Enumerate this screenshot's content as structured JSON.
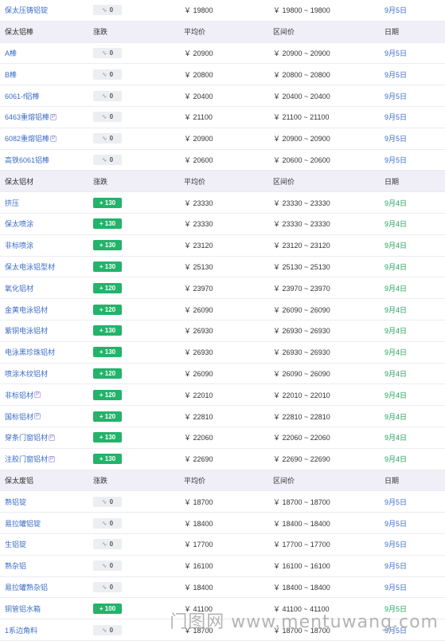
{
  "watermark": "门图网 www.mentuwang.com",
  "sections": [
    {
      "header": {
        "name": "保太压铸铝锭",
        "change_label": "",
        "avg_label": "",
        "range_label": "",
        "date_label": "",
        "hidden_header": true
      },
      "rows": [
        {
          "name": "保太压铸铝锭",
          "change": "0",
          "change_type": "zero",
          "avg": "￥ 19800",
          "range": "￥ 19800 ~ 19800",
          "date": "9月5日",
          "date_color": "blue",
          "mark": false
        }
      ]
    },
    {
      "header": {
        "name": "保太铝棒",
        "change_label": "涨跌",
        "avg_label": "平均价",
        "range_label": "区间价",
        "date_label": "日期"
      },
      "rows": [
        {
          "name": "A棒",
          "change": "0",
          "change_type": "zero",
          "avg": "￥ 20900",
          "range": "￥ 20900 ~ 20900",
          "date": "9月5日",
          "date_color": "blue",
          "mark": false
        },
        {
          "name": "B棒",
          "change": "0",
          "change_type": "zero",
          "avg": "￥ 20800",
          "range": "￥ 20800 ~ 20800",
          "date": "9月5日",
          "date_color": "blue",
          "mark": false
        },
        {
          "name": "6061-f铝棒",
          "change": "0",
          "change_type": "zero",
          "avg": "￥ 20400",
          "range": "￥ 20400 ~ 20400",
          "date": "9月5日",
          "date_color": "blue",
          "mark": false
        },
        {
          "name": "6463重熔铝棒",
          "change": "0",
          "change_type": "zero",
          "avg": "￥ 21100",
          "range": "￥ 21100 ~ 21100",
          "date": "9月5日",
          "date_color": "blue",
          "mark": true
        },
        {
          "name": "6082重熔铝棒",
          "change": "0",
          "change_type": "zero",
          "avg": "￥ 20900",
          "range": "￥ 20900 ~ 20900",
          "date": "9月5日",
          "date_color": "blue",
          "mark": true
        },
        {
          "name": "高铁6061铝棒",
          "change": "0",
          "change_type": "zero",
          "avg": "￥ 20600",
          "range": "￥ 20600 ~ 20600",
          "date": "9月5日",
          "date_color": "blue",
          "mark": false
        }
      ]
    },
    {
      "header": {
        "name": "保太铝材",
        "change_label": "涨跌",
        "avg_label": "平均价",
        "range_label": "区间价",
        "date_label": "日期"
      },
      "rows": [
        {
          "name": "挤压",
          "change": "+ 130",
          "change_type": "up",
          "avg": "￥ 23330",
          "range": "￥ 23330 ~ 23330",
          "date": "9月4日",
          "date_color": "green",
          "mark": false
        },
        {
          "name": "保太喷涂",
          "change": "+ 130",
          "change_type": "up",
          "avg": "￥ 23330",
          "range": "￥ 23330 ~ 23330",
          "date": "9月4日",
          "date_color": "green",
          "mark": false
        },
        {
          "name": "非标喷涂",
          "change": "+ 130",
          "change_type": "up",
          "avg": "￥ 23120",
          "range": "￥ 23120 ~ 23120",
          "date": "9月4日",
          "date_color": "green",
          "mark": false
        },
        {
          "name": "保太电泳铝型材",
          "change": "+ 130",
          "change_type": "up",
          "avg": "￥ 25130",
          "range": "￥ 25130 ~ 25130",
          "date": "9月4日",
          "date_color": "green",
          "mark": false
        },
        {
          "name": "氧化铝材",
          "change": "+ 120",
          "change_type": "up",
          "avg": "￥ 23970",
          "range": "￥ 23970 ~ 23970",
          "date": "9月4日",
          "date_color": "green",
          "mark": false
        },
        {
          "name": "金黄电泳铝材",
          "change": "+ 120",
          "change_type": "up",
          "avg": "￥ 26090",
          "range": "￥ 26090 ~ 26090",
          "date": "9月4日",
          "date_color": "green",
          "mark": false
        },
        {
          "name": "紫铜电泳铝材",
          "change": "+ 130",
          "change_type": "up",
          "avg": "￥ 26930",
          "range": "￥ 26930 ~ 26930",
          "date": "9月4日",
          "date_color": "green",
          "mark": false
        },
        {
          "name": "电泳黑珍珠铝材",
          "change": "+ 130",
          "change_type": "up",
          "avg": "￥ 26930",
          "range": "￥ 26930 ~ 26930",
          "date": "9月4日",
          "date_color": "green",
          "mark": false
        },
        {
          "name": "喷涂木纹铝材",
          "change": "+ 120",
          "change_type": "up",
          "avg": "￥ 26090",
          "range": "￥ 26090 ~ 26090",
          "date": "9月4日",
          "date_color": "green",
          "mark": false
        },
        {
          "name": "非标铝材",
          "change": "+ 120",
          "change_type": "up",
          "avg": "￥ 22010",
          "range": "￥ 22010 ~ 22010",
          "date": "9月4日",
          "date_color": "green",
          "mark": true
        },
        {
          "name": "国标铝材",
          "change": "+ 120",
          "change_type": "up",
          "avg": "￥ 22810",
          "range": "￥ 22810 ~ 22810",
          "date": "9月4日",
          "date_color": "green",
          "mark": true
        },
        {
          "name": "穿条门窗铝材",
          "change": "+ 130",
          "change_type": "up",
          "avg": "￥ 22060",
          "range": "￥ 22060 ~ 22060",
          "date": "9月4日",
          "date_color": "green",
          "mark": true
        },
        {
          "name": "注胶门窗铝材",
          "change": "+ 130",
          "change_type": "up",
          "avg": "￥ 22690",
          "range": "￥ 22690 ~ 22690",
          "date": "9月4日",
          "date_color": "green",
          "mark": true
        }
      ]
    },
    {
      "header": {
        "name": "保太废铝",
        "change_label": "涨跌",
        "avg_label": "平均价",
        "range_label": "区间价",
        "date_label": "日期"
      },
      "rows": [
        {
          "name": "熟铝锭",
          "change": "0",
          "change_type": "zero",
          "avg": "￥ 18700",
          "range": "￥ 18700 ~ 18700",
          "date": "9月5日",
          "date_color": "blue",
          "mark": false
        },
        {
          "name": "易拉罐铝锭",
          "change": "0",
          "change_type": "zero",
          "avg": "￥ 18400",
          "range": "￥ 18400 ~ 18400",
          "date": "9月5日",
          "date_color": "blue",
          "mark": false
        },
        {
          "name": "生铝锭",
          "change": "0",
          "change_type": "zero",
          "avg": "￥ 17700",
          "range": "￥ 17700 ~ 17700",
          "date": "9月5日",
          "date_color": "blue",
          "mark": false
        },
        {
          "name": "熟杂铝",
          "change": "0",
          "change_type": "zero",
          "avg": "￥ 16100",
          "range": "￥ 16100 ~ 16100",
          "date": "9月5日",
          "date_color": "blue",
          "mark": false
        },
        {
          "name": "易拉罐熟杂铝",
          "change": "0",
          "change_type": "zero",
          "avg": "￥ 18400",
          "range": "￥ 18400 ~ 18400",
          "date": "9月5日",
          "date_color": "blue",
          "mark": false
        },
        {
          "name": "铜管铝水箱",
          "change": "+ 100",
          "change_type": "up",
          "avg": "￥ 41100",
          "range": "￥ 41100 ~ 41100",
          "date": "9月5日",
          "date_color": "green",
          "mark": false
        },
        {
          "name": "1系边角料",
          "change": "0",
          "change_type": "zero",
          "avg": "￥ 18700",
          "range": "￥ 18700 ~ 18700",
          "date": "9月5日",
          "date_color": "blue",
          "mark": false
        }
      ]
    }
  ]
}
